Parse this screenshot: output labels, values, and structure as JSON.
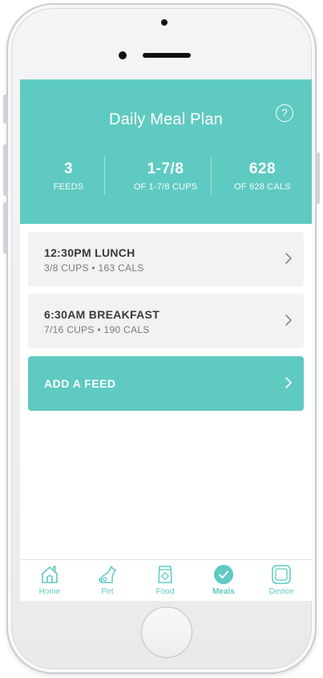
{
  "header": {
    "title": "Daily Meal Plan",
    "help_glyph": "?"
  },
  "stats": [
    {
      "value": "3",
      "label": "FEEDS"
    },
    {
      "value": "1-7/8",
      "label": "OF 1-7/8 CUPS"
    },
    {
      "value": "628",
      "label": "OF 628 CALS"
    }
  ],
  "feeds": [
    {
      "title": "12:30PM LUNCH",
      "detail": "3/8 CUPS  •  163 CALS"
    },
    {
      "title": "6:30AM BREAKFAST",
      "detail": "7/16 CUPS  •  190 CALS"
    }
  ],
  "add_feed": {
    "label": "ADD A FEED"
  },
  "tabbar": {
    "active": "Meals",
    "tabs": [
      {
        "label": "Home",
        "icon": "home-icon"
      },
      {
        "label": "Pet",
        "icon": "pet-icon"
      },
      {
        "label": "Food",
        "icon": "food-bag-icon"
      },
      {
        "label": "Meals",
        "icon": "check-circle-icon"
      },
      {
        "label": "Device",
        "icon": "device-icon"
      }
    ]
  },
  "colors": {
    "accent": "#5fcac1",
    "card_bg": "#f2f2f2",
    "text_dark": "#3a3a3a",
    "text_muted": "#7a7a7a"
  }
}
